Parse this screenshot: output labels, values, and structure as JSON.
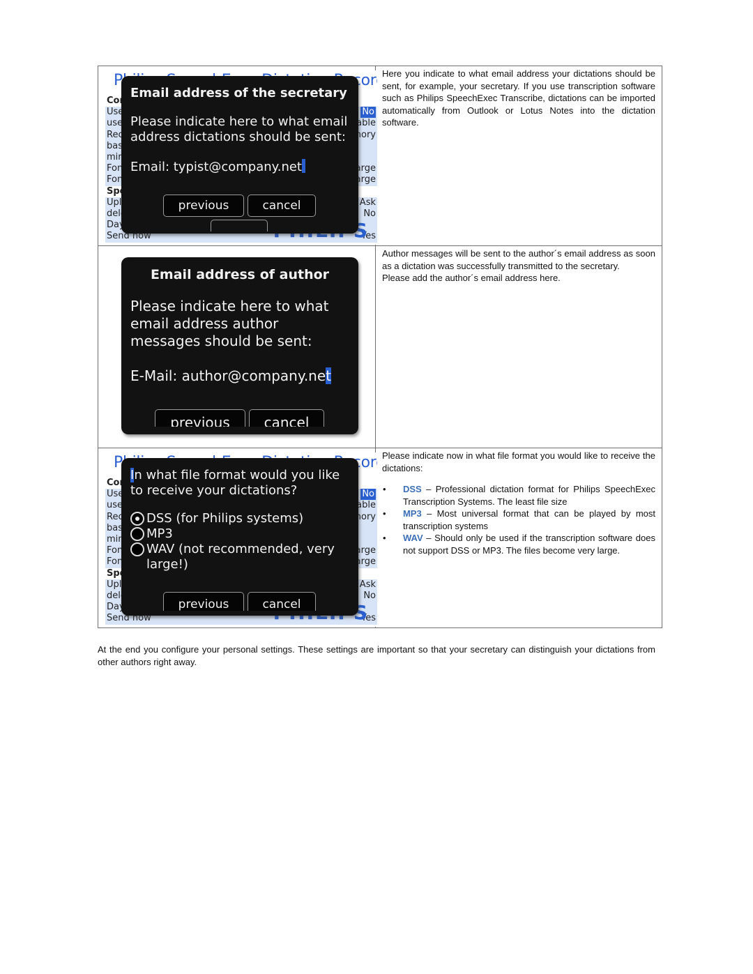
{
  "rows": [
    {
      "screen": {
        "app_title": "Philips SpeechExec Dictation Recorder",
        "background_list": [
          {
            "label": "Connectivity:",
            "value": "",
            "head": true
          },
          {
            "label": "Use BES for networking connection?",
            "value": "No",
            "selected": true
          },
          {
            "label": "use WLAN:",
            "value": "if available"
          },
          {
            "label": "Recorder:",
            "value": "SD-card and internal memory"
          },
          {
            "label": "base path: Dic/",
            "value": ""
          },
          {
            "label": "minimum free memory (MB): 1",
            "value": ""
          },
          {
            "label": "Font (list):",
            "value": "large"
          },
          {
            "label": "Font (recorder):",
            "value": "large"
          },
          {
            "label": "SpeechExec",
            "value": "",
            "head": true
          },
          {
            "label": "Upload Mode:",
            "value": "Ask"
          },
          {
            "label": "delete:",
            "value": "No"
          },
          {
            "label": "Days until final deletion of sent dictations: 3",
            "value": ""
          },
          {
            "label": "Send now",
            "value": "Yes"
          }
        ],
        "logo": "PHILIPS"
      },
      "dialog": {
        "title": "Email address of the secretary",
        "prompt": "Please indicate here to what email address dictations should be sent:",
        "field_label": "Email:",
        "field_value": "typist@company.net",
        "buttons": {
          "previous": "previous",
          "cancel": "cancel"
        }
      },
      "description": "Here you indicate to what email address your dictations should be sent, for example, your secretary. If you use transcription software such as Philips SpeechExec Transcribe, dictations can be imported automatically from Outlook or Lotus Notes into the dictation software."
    },
    {
      "dialog": {
        "title": "Email address of author",
        "prompt": "Please indicate here to what email address author messages should be sent:",
        "field_label": "E-Mail:",
        "field_value_main": "author@company.ne",
        "field_value_selected": "t",
        "buttons": {
          "previous": "previous",
          "cancel": "cancel"
        }
      },
      "description": "Author messages will be sent to the author´s email address as soon as a dictation was successfully transmitted to the secretary.",
      "description2": "Please add the author´s email address here."
    },
    {
      "screen": {
        "app_title": "Philips SpeechExec Dictation Recorder",
        "logo": "PHILIPS"
      },
      "dialog": {
        "prompt_first": "I",
        "prompt_rest": "n what file format would you like to receive your dictations?",
        "options": [
          {
            "label": "DSS (for Philips systems)",
            "checked": true
          },
          {
            "label": "MP3",
            "checked": false
          },
          {
            "label": "WAV (not recommended, very large!)",
            "checked": false
          }
        ],
        "buttons": {
          "previous": "previous",
          "cancel": "cancel"
        }
      },
      "description": "Please indicate now in what file format you would like to receive the dictations:",
      "formats": [
        {
          "name": "DSS",
          "text": " – Professional dictation format for Philips SpeechExec Transcription Systems. The least file size"
        },
        {
          "name": "MP3",
          "text": " – Most universal format that can be played by most transcription systems"
        },
        {
          "name": "WAV",
          "text": " – Should only be used if the transcription software does not support DSS or MP3. The files become very large."
        }
      ]
    }
  ],
  "footer": "At the end you configure your personal settings. These settings are important so that your secretary can distinguish your dictations from other authors right away.",
  "colors": {
    "accent_blue": "#2a5fd0",
    "keyword_blue": "#3c6fb8",
    "dialog_bg": "#121212"
  }
}
